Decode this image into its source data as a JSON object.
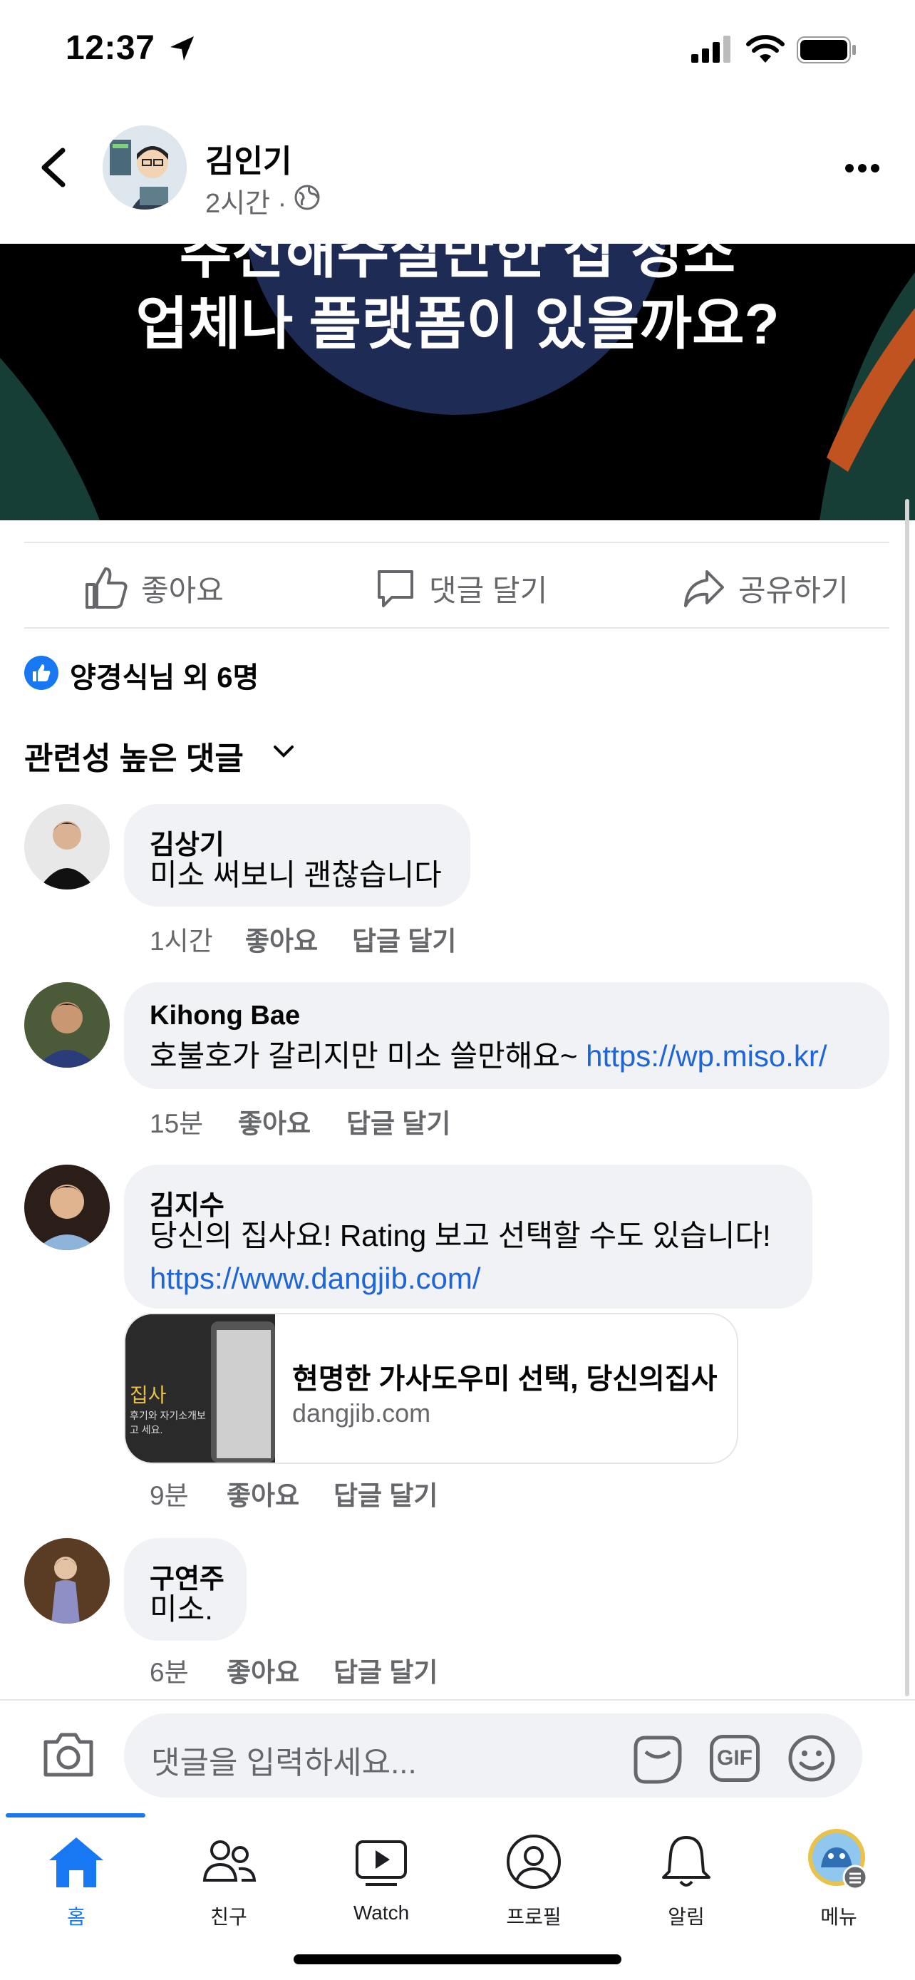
{
  "status_bar": {
    "time": "12:37"
  },
  "header": {
    "author": "김인기",
    "meta": "2시간 ·"
  },
  "banner": {
    "line1": "추천해주실만한 집 청소",
    "line2": "업체나 플랫폼이 있을까요?"
  },
  "actions": {
    "like": "좋아요",
    "comment": "댓글 달기",
    "share": "공유하기"
  },
  "reactions": {
    "text": "양경식님 외 6명"
  },
  "sort": {
    "label": "관련성 높은 댓글"
  },
  "comments": [
    {
      "name": "김상기",
      "text": "미소 써보니 괜찮습니다",
      "time": "1시간",
      "like": "좋아요",
      "reply": "답글 달기"
    },
    {
      "name": "Kihong Bae",
      "text": "호불호가 갈리지만 미소 쓸만해요~ ",
      "link": "https://wp.miso.kr/",
      "time": "15분",
      "like": "좋아요",
      "reply": "답글 달기"
    },
    {
      "name": "김지수",
      "text": "당신의 집사요! Rating 보고 선택할 수도 있습니다!",
      "link": "https://www.dangjib.com/",
      "time": "9분",
      "like": "좋아요",
      "reply": "답글 달기",
      "preview": {
        "title": "현명한 가사도우미 선택, 당신의집사",
        "domain": "dangjib.com",
        "thumb_text": "집사",
        "thumb_sub": "후기와 자기소개보고 세요."
      }
    },
    {
      "name": "구연주",
      "text": "미소.",
      "time": "6분",
      "like": "좋아요",
      "reply": "답글 달기"
    }
  ],
  "composer": {
    "placeholder": "댓글을 입력하세요...",
    "gif": "GIF"
  },
  "tabs": [
    {
      "label": "홈",
      "icon": "home-icon",
      "active": true
    },
    {
      "label": "친구",
      "icon": "friends-icon"
    },
    {
      "label": "Watch",
      "icon": "watch-icon"
    },
    {
      "label": "프로필",
      "icon": "profile-icon"
    },
    {
      "label": "알림",
      "icon": "bell-icon"
    },
    {
      "label": "메뉴",
      "icon": "menu-avatar-icon"
    }
  ],
  "colors": {
    "accent": "#1877f2",
    "link": "#1d65d8",
    "bubble": "#f0f2f5",
    "muted": "#65676b"
  }
}
